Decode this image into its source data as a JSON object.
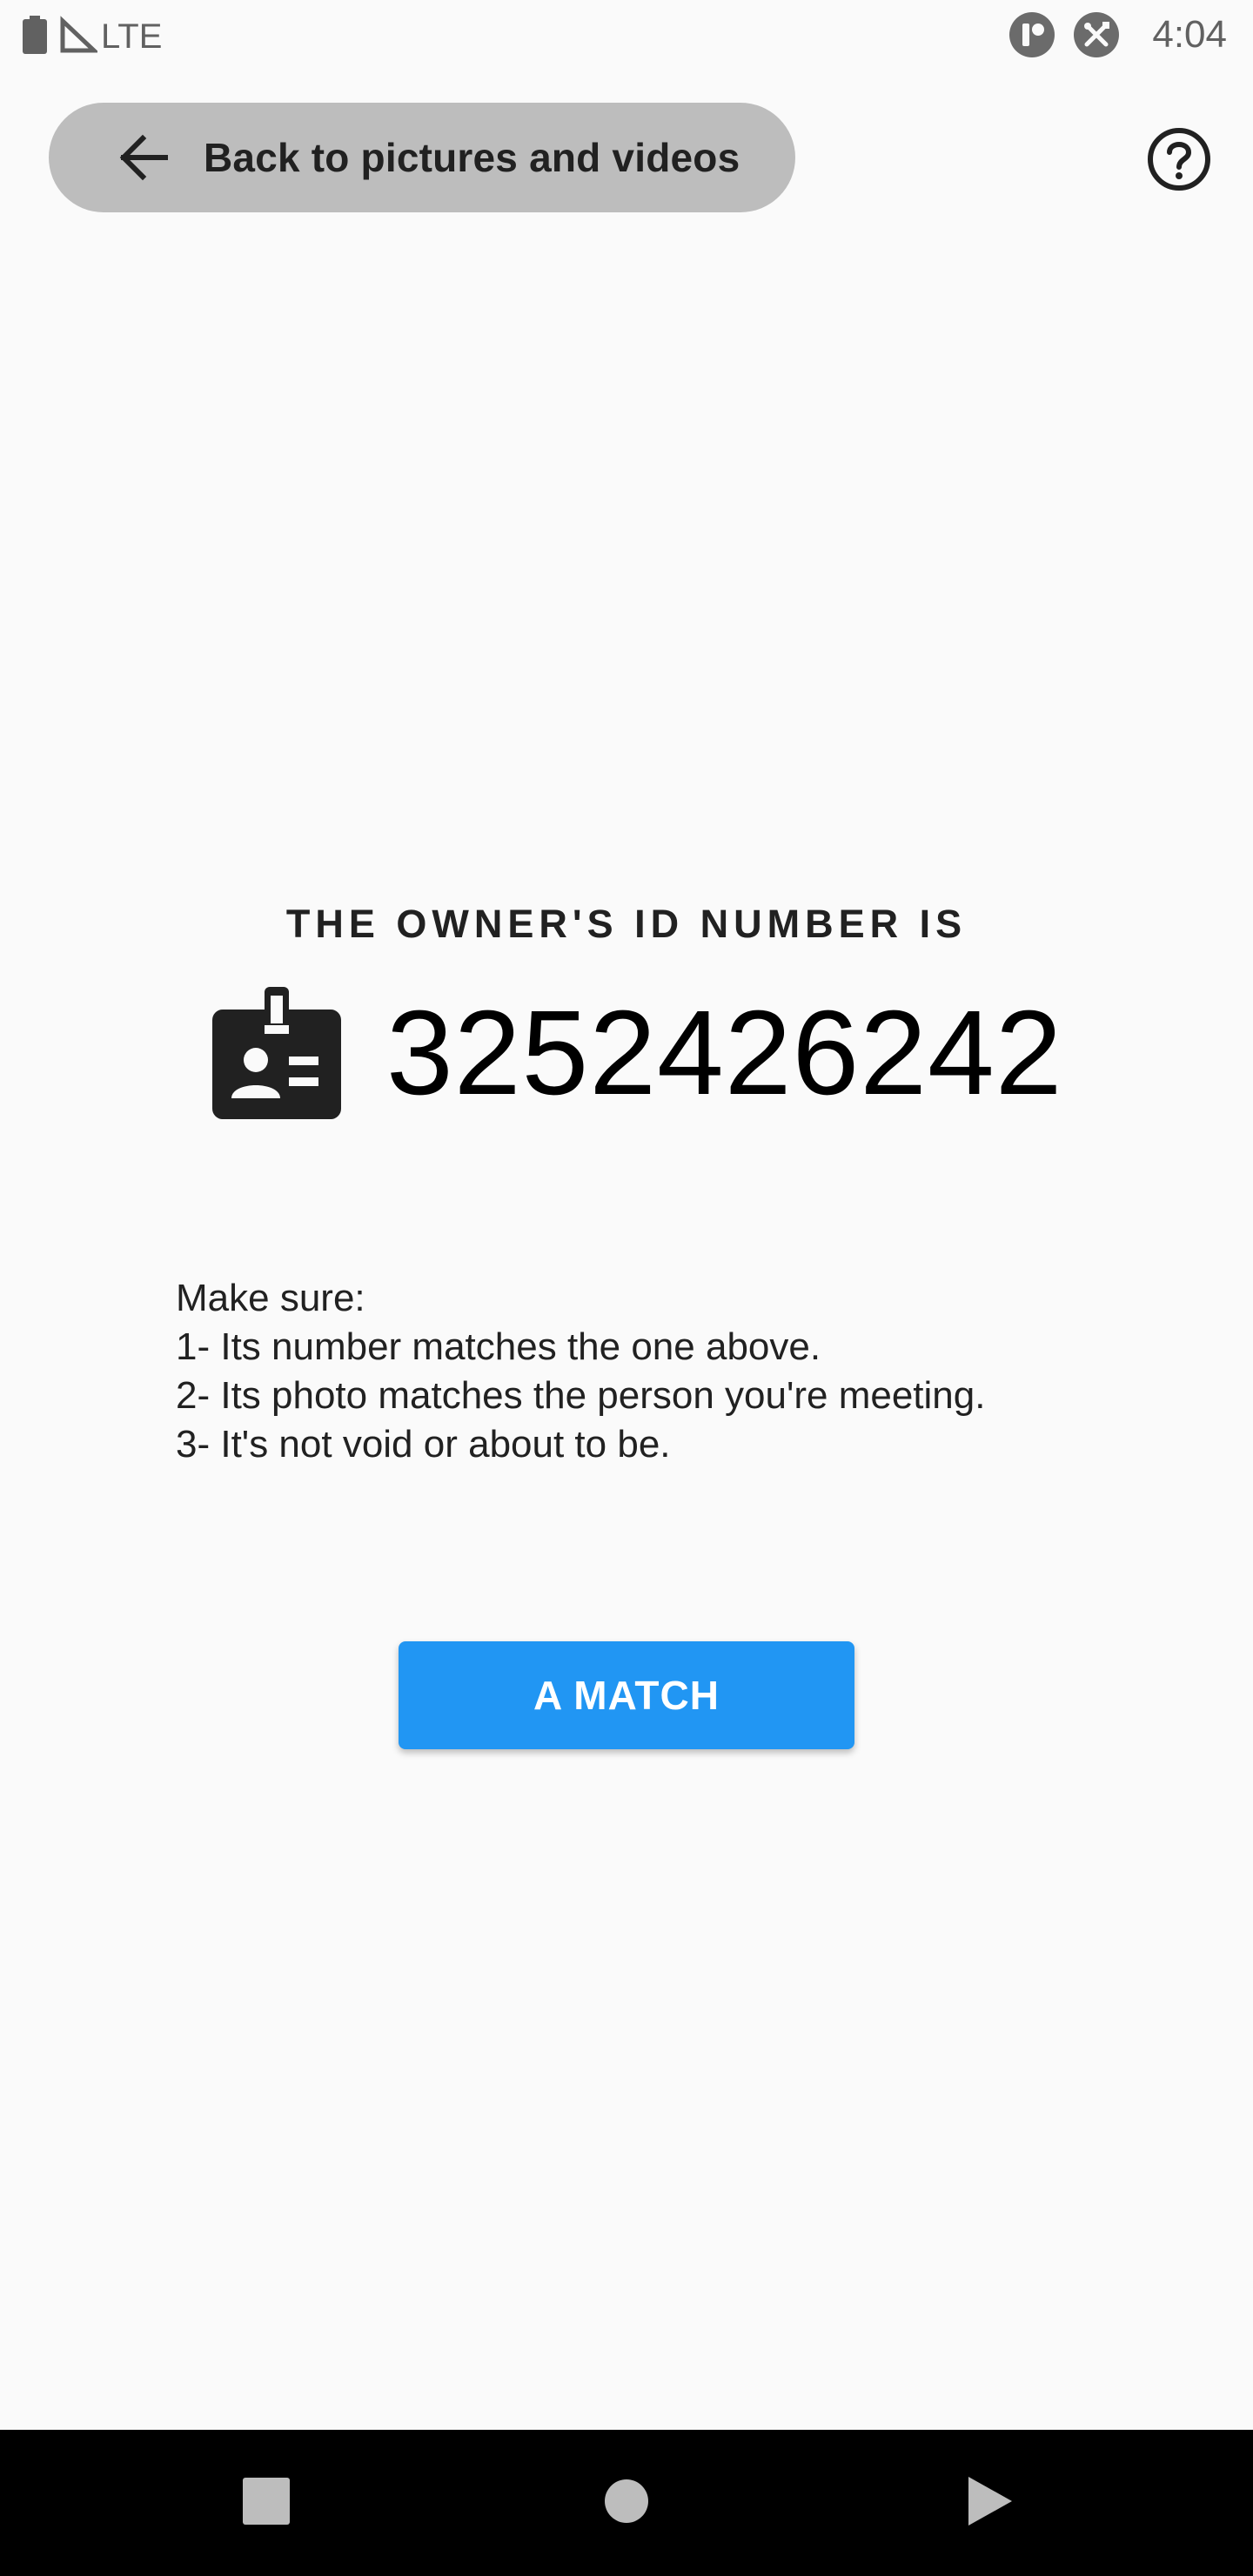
{
  "status_bar": {
    "network": "LTE",
    "time": "4:04",
    "icons": [
      "battery-icon",
      "signal-icon",
      "app-notification-icon",
      "tools-notification-icon"
    ]
  },
  "header": {
    "back_label": "Back to pictures and videos",
    "back_icon": "arrow-left-icon",
    "help_icon": "help-circle-icon"
  },
  "main": {
    "caption": "THE OWNER'S ID NUMBER IS",
    "id_icon": "id-badge-icon",
    "id_number": "3252426242",
    "instructions": [
      "Make sure:",
      "1- Its number matches the one above.",
      "2- Its photo matches the person you're meeting.",
      "3- It's not void or about to be."
    ],
    "match_button": "A MATCH"
  },
  "nav_bar": {
    "buttons": [
      "recents-icon",
      "home-icon",
      "back-icon"
    ]
  },
  "colors": {
    "background": "#fafafa",
    "back_button": "#bdbdbd",
    "accent": "#2196f3",
    "text": "#212121",
    "nav_bar": "#000000"
  }
}
